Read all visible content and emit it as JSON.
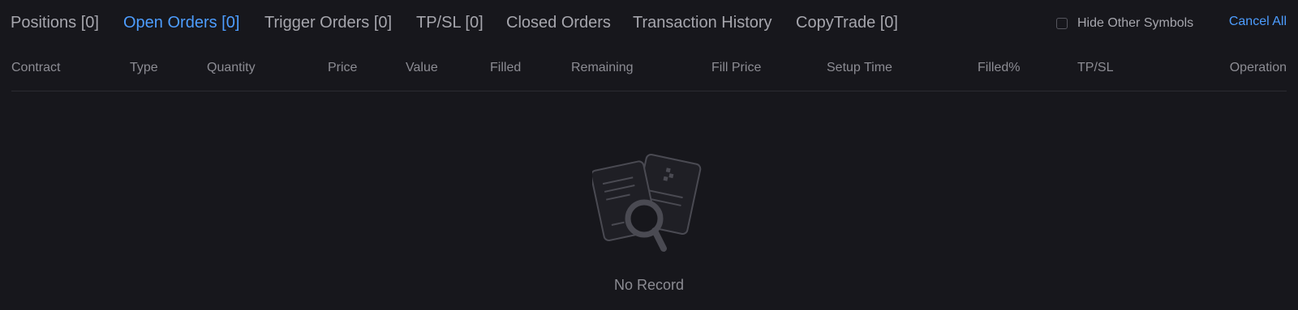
{
  "tabs": [
    {
      "label": "Positions [0]",
      "active": false
    },
    {
      "label": "Open Orders [0]",
      "active": true
    },
    {
      "label": "Trigger Orders [0]",
      "active": false
    },
    {
      "label": "TP/SL [0]",
      "active": false
    },
    {
      "label": "Closed Orders",
      "active": false
    },
    {
      "label": "Transaction History",
      "active": false
    },
    {
      "label": "CopyTrade [0]",
      "active": false
    }
  ],
  "controls": {
    "hide_other_symbols_label": "Hide Other Symbols",
    "hide_other_symbols_checked": false,
    "cancel_all_label": "Cancel All"
  },
  "table": {
    "columns": [
      "Contract",
      "Type",
      "Quantity",
      "Price",
      "Value",
      "Filled",
      "Remaining",
      "Fill Price",
      "Setup Time",
      "Filled%",
      "TP/SL",
      "Operation"
    ],
    "rows": []
  },
  "empty_state": {
    "icon": "document-search-icon",
    "text": "No Record"
  },
  "colors": {
    "background": "#17171c",
    "accent": "#4d9dff",
    "text_muted": "#a6a6ad"
  }
}
